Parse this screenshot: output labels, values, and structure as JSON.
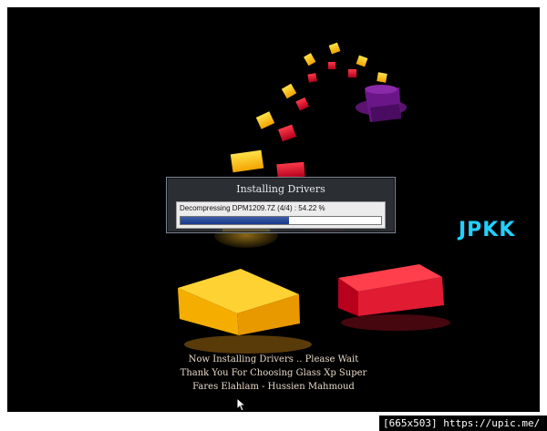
{
  "dialog": {
    "title": "Installing Drivers",
    "status_text": "Decompressing DPM1209.7Z  (4/4) : 54.22 %",
    "progress_percent": 54.22
  },
  "watermark": {
    "text": "JPKK"
  },
  "credits": {
    "line1": "Now Installing Drivers .. Please Wait",
    "line2": "Thank You For Choosing Glass Xp Super",
    "line3": "Fares Elahlam - Hussien Mahmoud"
  },
  "footer": {
    "text": "[665x503] https://upic.me/"
  },
  "icons": [
    "cursor-arrow-icon",
    "wizard-hat-icon"
  ],
  "colors": {
    "progress": "#1a3a8a",
    "watermark": "#22d0ff",
    "yellow_cube": "#ffc81e",
    "red_cube": "#e01b32"
  }
}
